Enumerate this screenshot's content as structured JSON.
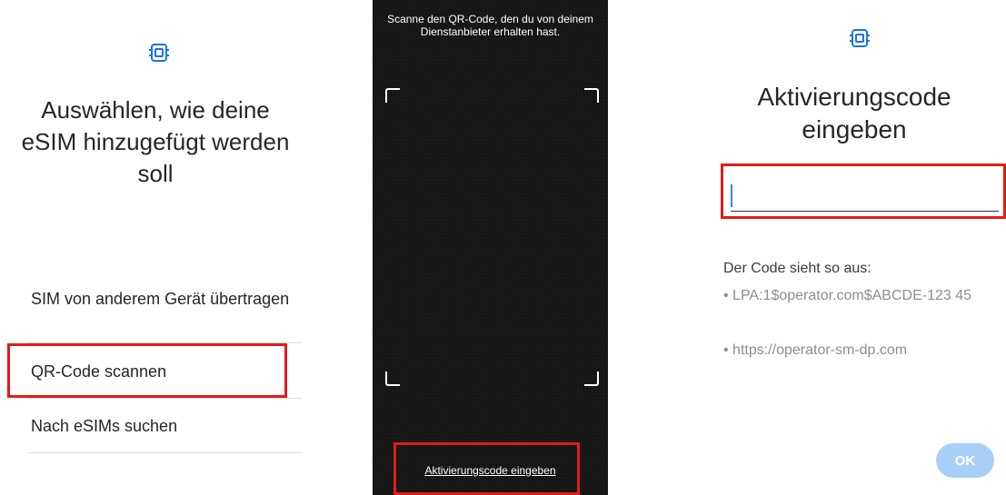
{
  "panel_add_method": {
    "title": "Auswählen, wie deine eSIM hinzugefügt werden soll",
    "icon": "esim-card-icon",
    "options": [
      {
        "label": "SIM von anderem Gerät übertragen"
      },
      {
        "label": "QR-Code scannen"
      },
      {
        "label": "Nach eSIMs suchen"
      }
    ]
  },
  "panel_qr_scanner": {
    "instruction": "Scanne den QR-Code, den du von deinem Dienstanbieter erhalten hast.",
    "manual_entry_link": "Aktivierungscode eingeben"
  },
  "panel_activation_code": {
    "icon": "esim-card-icon",
    "title": "Aktivierungscode eingeben",
    "input_value": "",
    "hint_title": "Der Code sieht so aus:",
    "hint_examples": [
      "• LPA:1$operator.com$ABCDE-123 45",
      "• https://operator-sm-dp.com"
    ],
    "ok_label": "OK"
  },
  "colors": {
    "accent": "#1a73e8",
    "highlight": "#e41b17",
    "ok_disabled": "#a8d0f6",
    "scanner_bg": "#161616"
  }
}
